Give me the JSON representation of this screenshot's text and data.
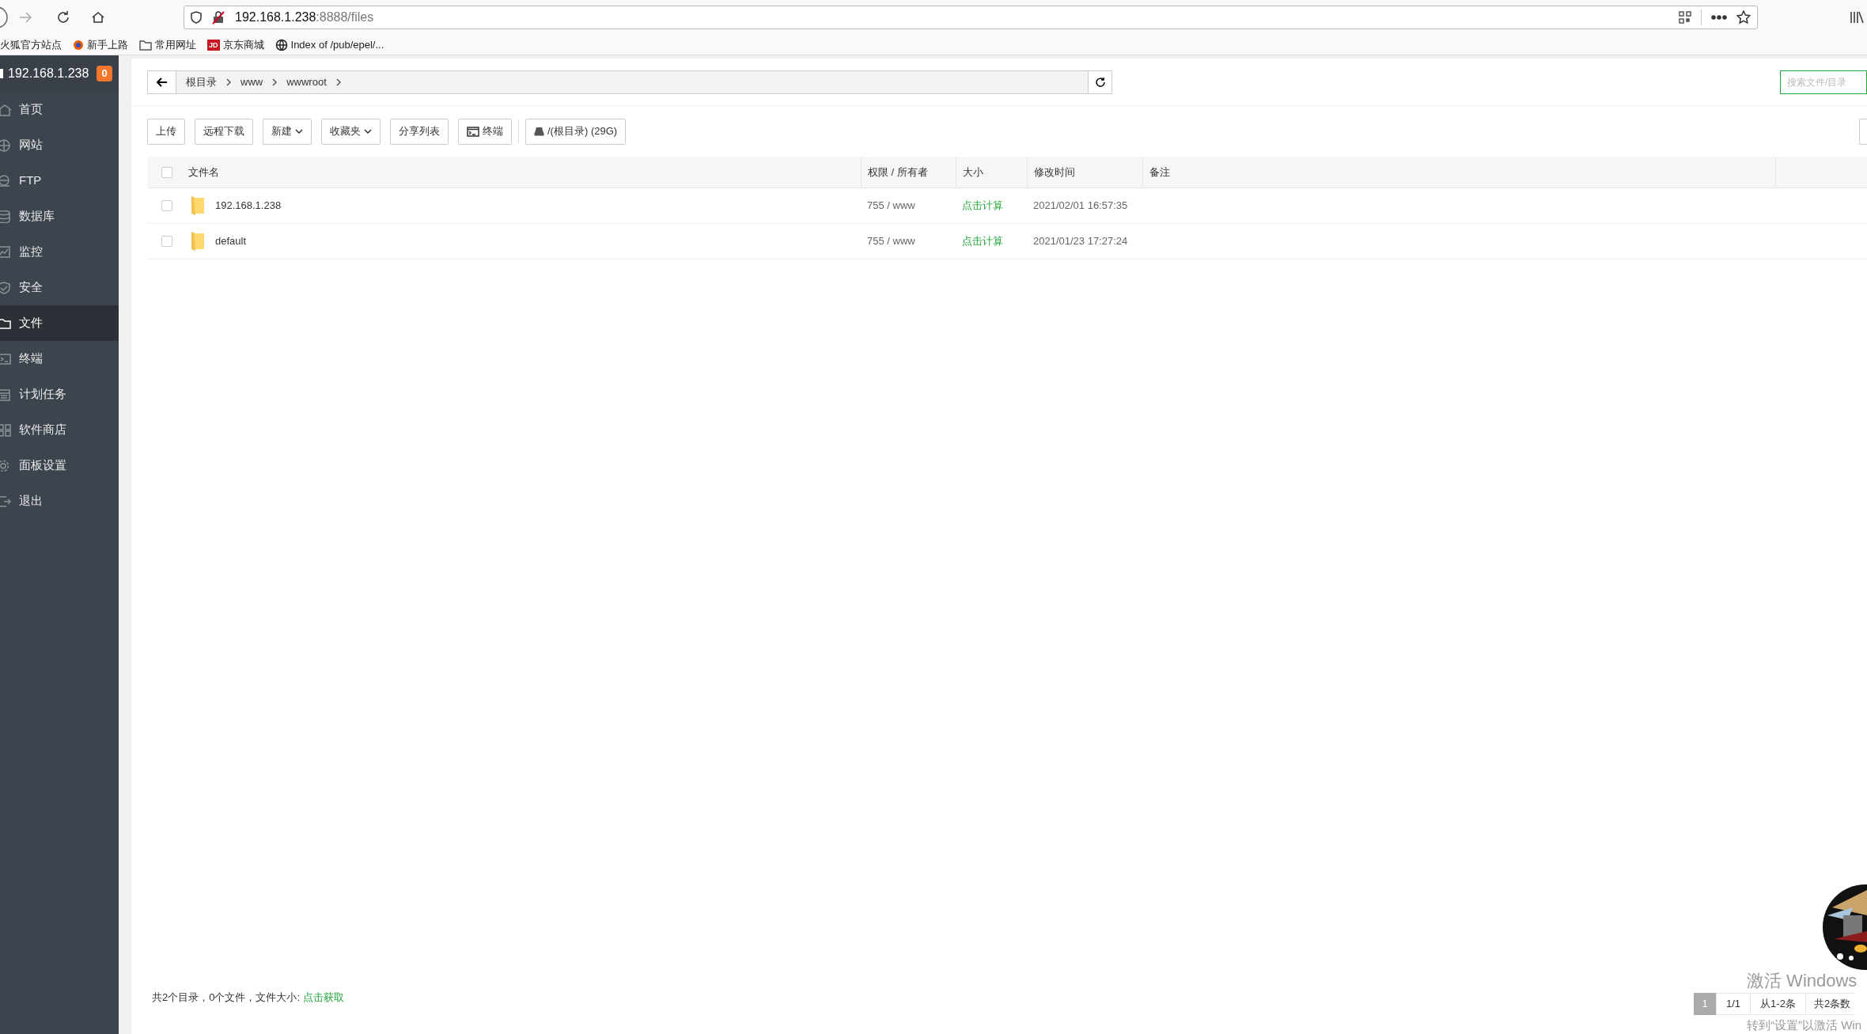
{
  "browser": {
    "url": {
      "host": "192.168.1.238",
      "path": ":8888/files"
    },
    "bookmarks": [
      {
        "label": "火狐官方站点",
        "kind": "plain"
      },
      {
        "label": "新手上路",
        "kind": "firefox"
      },
      {
        "label": "常用网址",
        "kind": "folder"
      },
      {
        "label": "京东商城",
        "kind": "jd",
        "badge": "JD"
      },
      {
        "label": "Index of /pub/epel/...",
        "kind": "globe"
      }
    ]
  },
  "sidebar": {
    "server": "192.168.1.238",
    "badge": "0",
    "items": [
      {
        "label": "首页",
        "kind": "home",
        "selected": false
      },
      {
        "label": "网站",
        "kind": "globe",
        "selected": false
      },
      {
        "label": "FTP",
        "kind": "ftp",
        "selected": false
      },
      {
        "label": "数据库",
        "kind": "database",
        "selected": false
      },
      {
        "label": "监控",
        "kind": "monitor",
        "selected": false
      },
      {
        "label": "安全",
        "kind": "shield",
        "selected": false
      },
      {
        "label": "文件",
        "kind": "folder",
        "selected": true
      },
      {
        "label": "终端",
        "kind": "terminal",
        "selected": false
      },
      {
        "label": "计划任务",
        "kind": "calendar",
        "selected": false
      },
      {
        "label": "软件商店",
        "kind": "apps",
        "selected": false
      },
      {
        "label": "面板设置",
        "kind": "gear",
        "selected": false
      },
      {
        "label": "退出",
        "kind": "exit",
        "selected": false
      }
    ]
  },
  "breadcrumb": {
    "segments": [
      "根目录",
      "www",
      "wwwroot"
    ]
  },
  "search": {
    "placeholder": "搜索文件/目录"
  },
  "toolbar": {
    "buttons": [
      {
        "label": "上传",
        "kind": "plain"
      },
      {
        "label": "远程下载",
        "kind": "plain"
      },
      {
        "label": "新建",
        "kind": "dropdown"
      },
      {
        "label": "收藏夹",
        "kind": "dropdown"
      },
      {
        "label": "分享列表",
        "kind": "plain"
      },
      {
        "label": "终端",
        "kind": "terminal"
      },
      {
        "label": "/(根目录) (29G)",
        "kind": "disk"
      }
    ]
  },
  "table": {
    "header_checked": false,
    "columns": [
      "文件名",
      "权限 / 所有者",
      "大小",
      "修改时间",
      "备注"
    ],
    "rows": [
      {
        "checked": false,
        "name": "192.168.1.238",
        "permission": "755 / www",
        "size": "点击计算",
        "modified": "2021/02/01 16:57:35"
      },
      {
        "checked": false,
        "name": "default",
        "permission": "755 / www",
        "size": "点击计算",
        "modified": "2021/01/23 17:27:24"
      }
    ]
  },
  "footer": {
    "summary": "共2个目录，0个文件，文件大小:",
    "link": "点击获取"
  },
  "pagination": {
    "current": "1",
    "pages": "1/1",
    "range": "从1-2条",
    "total": "共2条数"
  },
  "os_notice": {
    "title": "激活 Windows",
    "hint": "转到“设置”以激活 Win"
  }
}
